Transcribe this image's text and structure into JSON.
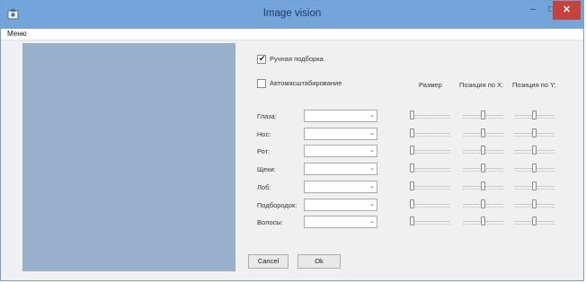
{
  "window": {
    "title": "Image vision",
    "minimize": "–",
    "maximize": "□",
    "close": "✕"
  },
  "menu": {
    "label": "Меню"
  },
  "options": {
    "manual_label": "Ручная подборка",
    "manual_checked": true,
    "auto_label": "Автомасштабирование",
    "auto_checked": false
  },
  "columns": {
    "size": "Размер",
    "pos_x": "Позиция по X:",
    "pos_y": "Позиция по Y:"
  },
  "rows": [
    {
      "label": "Глаза:",
      "size_level": 0.0,
      "x_level": 0.5,
      "y_level": 0.5
    },
    {
      "label": "Нос:",
      "size_level": 0.0,
      "x_level": 0.5,
      "y_level": 0.5
    },
    {
      "label": "Рот:",
      "size_level": 0.0,
      "x_level": 0.5,
      "y_level": 0.5
    },
    {
      "label": "Щеки:",
      "size_level": 0.0,
      "x_level": 0.5,
      "y_level": 0.5
    },
    {
      "label": "Лоб:",
      "size_level": 0.0,
      "x_level": 0.5,
      "y_level": 0.5
    },
    {
      "label": "Подбородок:",
      "size_level": 0.0,
      "x_level": 0.5,
      "y_level": 0.5
    },
    {
      "label": "Волосы:",
      "size_level": 0.0,
      "x_level": 0.5,
      "y_level": 0.5
    }
  ],
  "buttons": {
    "cancel": "Cancel",
    "ok": "Ok"
  },
  "icons": {
    "app": "app-icon",
    "combo_arrow": "chevron-down-icon"
  }
}
